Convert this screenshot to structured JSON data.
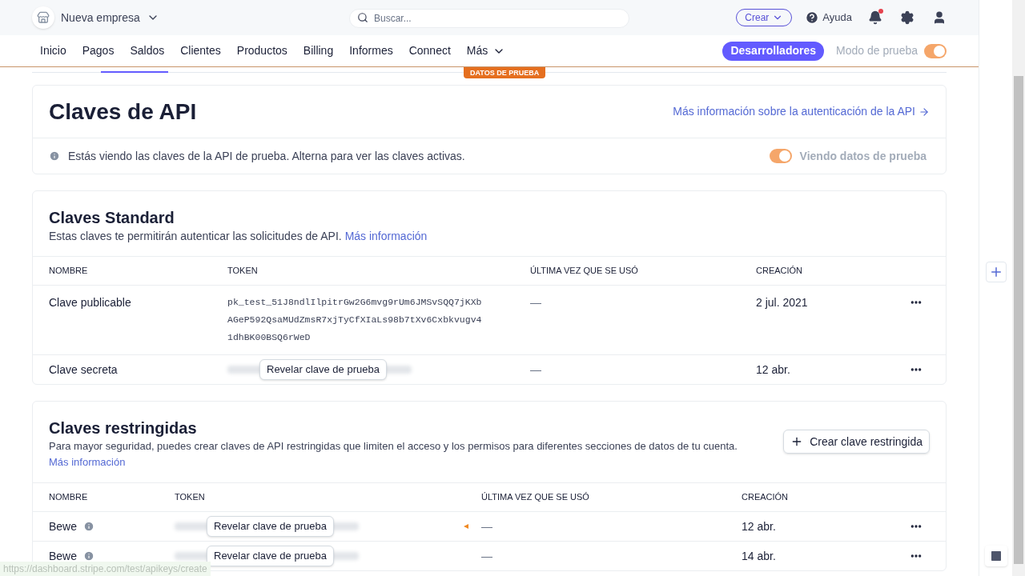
{
  "top_bar": {
    "company": "Nueva empresa",
    "search": {
      "placeholder": "Buscar..."
    },
    "create_button": "Crear",
    "help": "Ayuda",
    "notification_dot": true
  },
  "nav": {
    "items": [
      {
        "label": "Inicio"
      },
      {
        "label": "Pagos"
      },
      {
        "label": "Saldos"
      },
      {
        "label": "Clientes"
      },
      {
        "label": "Productos"
      },
      {
        "label": "Billing"
      },
      {
        "label": "Informes"
      },
      {
        "label": "Connect"
      },
      {
        "label": "Más",
        "kind": "menu"
      }
    ],
    "developers_button": "Desarrolladores",
    "test_mode": {
      "label": "Modo de prueba",
      "on": true
    }
  },
  "test_badge": "DATOS DE PRUEBA",
  "header_card": {
    "title": "Claves de API",
    "link": "Más información sobre la autenticación de la API",
    "notice": "Estás viendo las claves de la API de prueba. Alterna para ver las claves activas.",
    "toggle": {
      "label": "Viendo datos de prueba",
      "on": true
    }
  },
  "standard_keys": {
    "title": "Claves Standard",
    "description": "Estas claves te permitirán autenticar las solicitudes de API.",
    "link": "Más información",
    "columns": [
      "NOMBRE",
      "TOKEN",
      "ÚLTIMA VEZ QUE SE USÓ",
      "CREACIÓN"
    ],
    "rows": [
      {
        "name": "Clave publicable",
        "kind": "visible",
        "token": [
          "pk_test_51J8ndlIlpitrGw2G6mvg9rUm6JMSvSQQ7jKXb",
          "AGeP592QsaMUdZmsR7xjTyCfXIaLs98b7tXv6Cxbkvugv4",
          "1dhBK00BSQ6rWeD"
        ],
        "last_used": "—",
        "created": "2 jul. 2021"
      },
      {
        "name": "Clave secreta",
        "kind": "hidden",
        "reveal_button": "Revelar clave de prueba",
        "last_used": "—",
        "created": "12 abr."
      }
    ]
  },
  "restricted_keys": {
    "title": "Claves restringidas",
    "description": "Para mayor seguridad, puedes crear claves de API restringidas que limiten el acceso y los permisos para diferentes secciones de datos de tu cuenta.",
    "link": "Más información",
    "create_button": "Crear clave restringida",
    "columns": [
      "NOMBRE",
      "TOKEN",
      "ÚLTIMA VEZ QUE SE USÓ",
      "CREACIÓN"
    ],
    "rows": [
      {
        "name": "Bewe",
        "kind": "hidden",
        "reveal_button": "Revelar clave de prueba",
        "last_used": "—",
        "created": "12 abr."
      },
      {
        "name": "Bewe",
        "kind": "hidden",
        "reveal_button": "Revelar clave de prueba",
        "last_used": "—",
        "created": "14 abr."
      }
    ]
  },
  "status_url": "https://dashboard.stripe.com/test/apikeys/create"
}
